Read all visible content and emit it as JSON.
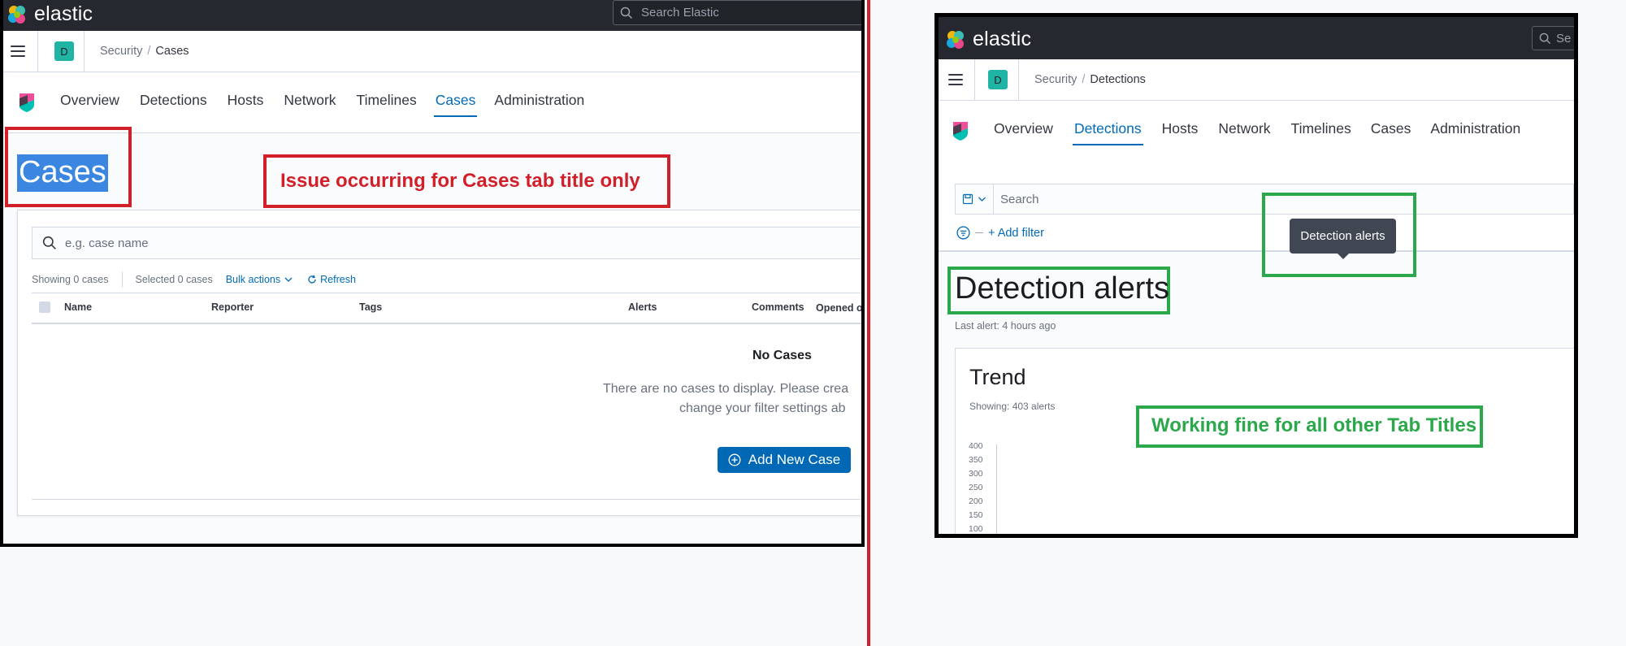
{
  "app": {
    "logo_text": "elastic",
    "search_placeholder": "Search Elastic",
    "search_placeholder_truncated": "Se"
  },
  "left": {
    "space_initial": "D",
    "breadcrumb": {
      "root": "Security",
      "separator": "/",
      "current": "Cases"
    },
    "tabs": [
      "Overview",
      "Detections",
      "Hosts",
      "Network",
      "Timelines",
      "Cases",
      "Administration"
    ],
    "active_tab": "Cases",
    "page_title": "Cases",
    "annotation": "Issue occurring for Cases tab title only",
    "search_placeholder": "e.g. case name",
    "toolbar": {
      "showing": "Showing 0 cases",
      "selected": "Selected 0 cases",
      "bulk_actions": "Bulk actions",
      "refresh": "Refresh"
    },
    "columns": [
      "Name",
      "Reporter",
      "Tags",
      "Alerts",
      "Comments",
      "Opened on"
    ],
    "empty": {
      "title": "No Cases",
      "line1": "There are no cases to display. Please crea",
      "line2": "change your filter settings ab"
    },
    "add_button": "Add New Case"
  },
  "right": {
    "space_initial": "D",
    "breadcrumb": {
      "root": "Security",
      "separator": "/",
      "current": "Detections"
    },
    "tabs": [
      "Overview",
      "Detections",
      "Hosts",
      "Network",
      "Timelines",
      "Cases",
      "Administration"
    ],
    "active_tab": "Detections",
    "search_placeholder": "Search",
    "add_filter": "+ Add filter",
    "tooltip": "Detection alerts",
    "page_title": "Detection alerts",
    "last_alert": "Last alert: 4 hours ago",
    "trend": {
      "title": "Trend",
      "showing": "Showing: 403 alerts",
      "yticks": [
        "400",
        "350",
        "300",
        "250",
        "200",
        "150",
        "100"
      ]
    },
    "annotation": "Working fine for all other Tab Titles"
  },
  "colors": {
    "accent": "#006bb8",
    "error": "#d2202a",
    "success": "#2aa84a",
    "topbar": "#25282f"
  }
}
